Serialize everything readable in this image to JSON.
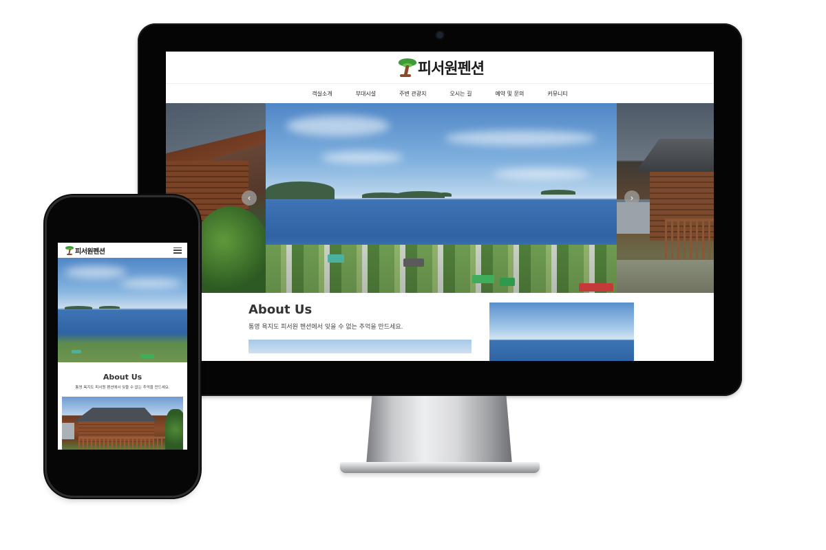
{
  "site": {
    "logo_text": "피서원펜션",
    "nav": [
      "객실소개",
      "부대시설",
      "주변 관광지",
      "오시는 길",
      "예약 및 문의",
      "커뮤니티"
    ],
    "slider": {
      "prev": "‹",
      "next": "›"
    },
    "about": {
      "title": "About Us",
      "subtitle": "통영 욕지도 피서원 펜션에서 잊을 수 없는 추억을 만드세요."
    }
  },
  "mobile": {
    "logo_text": "피서원펜션",
    "about": {
      "title": "About Us",
      "subtitle": "통영 욕지도 피서원 펜션에서 잊을 수 없는 추억을 만드세요."
    }
  },
  "colors": {
    "device_frame": "#050505",
    "text_primary": "#333333",
    "logo_green": "#3f9b3a",
    "logo_brown": "#8a4b2a"
  }
}
